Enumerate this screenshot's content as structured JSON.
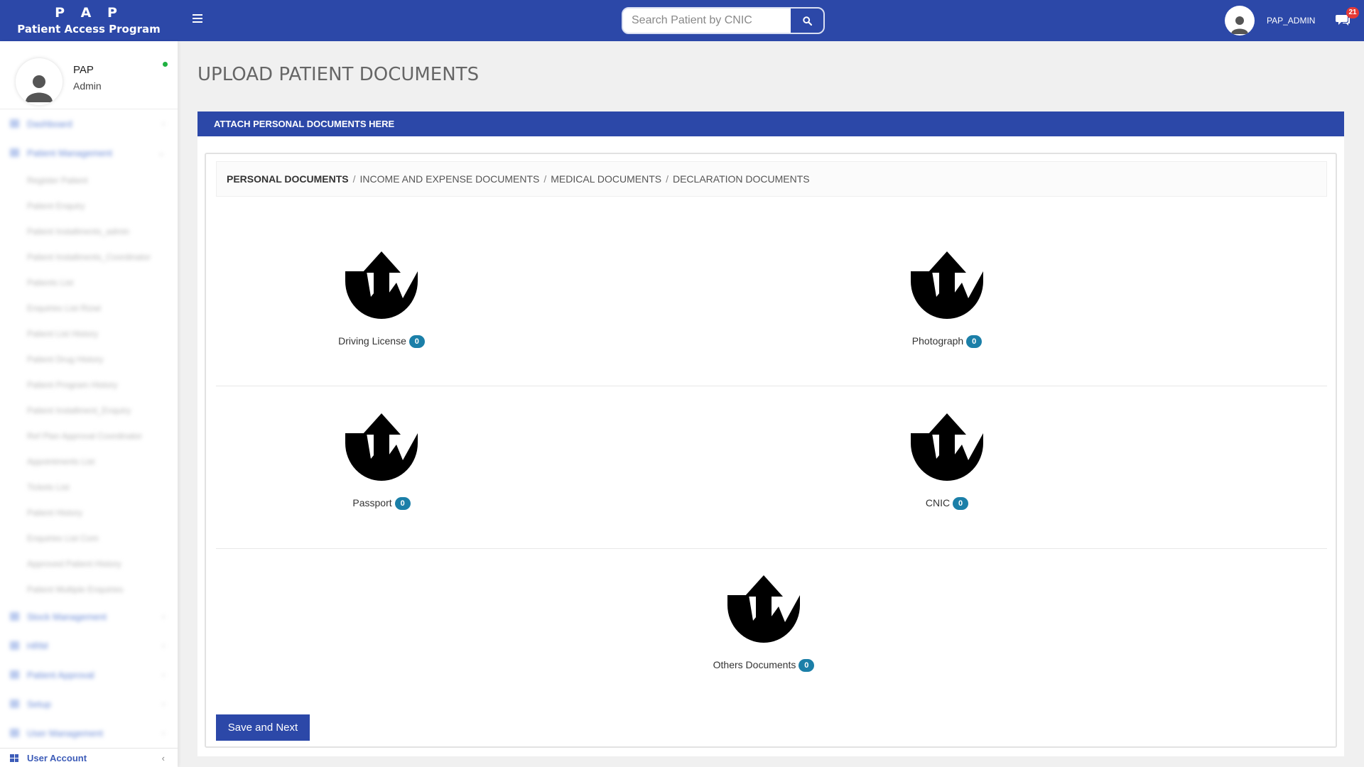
{
  "header": {
    "brand_title": "P A P",
    "brand_subtitle": "Patient Access Program",
    "search_placeholder": "Search Patient by CNIC",
    "username": "PAP_ADMIN",
    "message_count": "21"
  },
  "sidebar": {
    "profile_name": "PAP",
    "profile_role": "Admin",
    "items": [
      {
        "label": "Dashboard",
        "sub": []
      },
      {
        "label": "Patient Management",
        "sub": [
          "Register Patient",
          "Patient Enquiry",
          "Patient Installments_admin",
          "Patient Installments_Coordinator",
          "Patients List",
          "Enquiries List Rizwi",
          "Patient List History",
          "Patient Drug History",
          "Patient Program History",
          "Patient Installment_Enquiry",
          "Ref Plan Approval Coordinator",
          "Appointments List",
          "Tickets List",
          "Patient History",
          "Enquiries List Com",
          "Approved Patient History",
          "Patient Multiple Enquiries"
        ]
      },
      {
        "label": "Stock Management",
        "sub": []
      },
      {
        "label": "HRM",
        "sub": []
      },
      {
        "label": "Patient Approval",
        "sub": []
      },
      {
        "label": "Setup",
        "sub": []
      },
      {
        "label": "User Management",
        "sub": []
      }
    ],
    "user_account": "User Account"
  },
  "main": {
    "page_title": "UPLOAD PATIENT DOCUMENTS",
    "card_header": "ATTACH PERSONAL DOCUMENTS HERE",
    "breadcrumbs": [
      "PERSONAL DOCUMENTS",
      "INCOME AND EXPENSE DOCUMENTS",
      "MEDICAL DOCUMENTS",
      "DECLARATION DOCUMENTS"
    ],
    "uploads": [
      {
        "label": "Driving License",
        "count": "0"
      },
      {
        "label": "Photograph",
        "count": "0"
      },
      {
        "label": "Passport",
        "count": "0"
      },
      {
        "label": "CNIC",
        "count": "0"
      },
      {
        "label": "Others Documents",
        "count": "0"
      }
    ],
    "save_label": "Save and Next"
  },
  "colors": {
    "primary": "#2c48a8",
    "badge": "#1b7fa8",
    "online": "#1fb141",
    "notification": "#e53935"
  }
}
